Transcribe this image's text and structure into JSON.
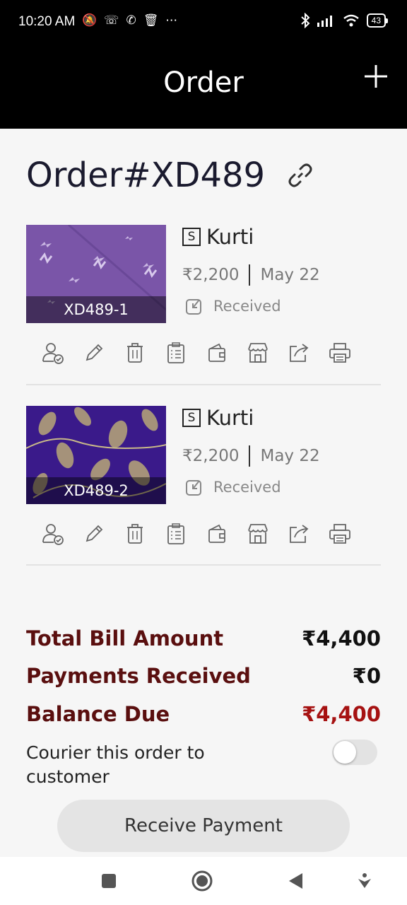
{
  "status_bar": {
    "time": "10:20 AM",
    "notification_icons": [
      "mute-alarm-icon",
      "missed-call-icon",
      "call-forward-icon",
      "trash-icon",
      "more-dots-icon"
    ],
    "right_icons": [
      "bluetooth-icon",
      "signal-icon",
      "wifi-icon"
    ],
    "battery": "43"
  },
  "app_bar": {
    "title": "Order",
    "action_icon": "plus-icon"
  },
  "order": {
    "title": "Order#XD489",
    "link_icon": "link-icon"
  },
  "items": [
    {
      "code": "XD489-1",
      "size": "S",
      "name": "Kurti",
      "price": "₹2,200",
      "date": "May 22",
      "status": "Received",
      "thumb_color": "#7a55a8"
    },
    {
      "code": "XD489-2",
      "size": "S",
      "name": "Kurti",
      "price": "₹2,200",
      "date": "May 22",
      "status": "Received",
      "thumb_color": "#3a1a8a"
    }
  ],
  "item_actions": [
    "assign-person-icon",
    "edit-pencil-icon",
    "delete-bin-icon",
    "checklist-icon",
    "wallet-icon",
    "store-icon",
    "share-icon",
    "print-icon"
  ],
  "summary": {
    "total_label": "Total Bill Amount",
    "total_value": "₹4,400",
    "received_label": "Payments Received",
    "received_value": "₹0",
    "due_label": "Balance Due",
    "due_value": "₹4,400"
  },
  "courier": {
    "label": "Courier this order to customer",
    "enabled": false
  },
  "receive_payment_label": "Receive Payment",
  "nav_bar": [
    "recents-square-icon",
    "home-circle-icon",
    "back-triangle-icon",
    "accessibility-icon"
  ],
  "colors": {
    "summary_label": "#5a0f0f",
    "balance_due": "#a61212",
    "header_bg": "#000000"
  }
}
